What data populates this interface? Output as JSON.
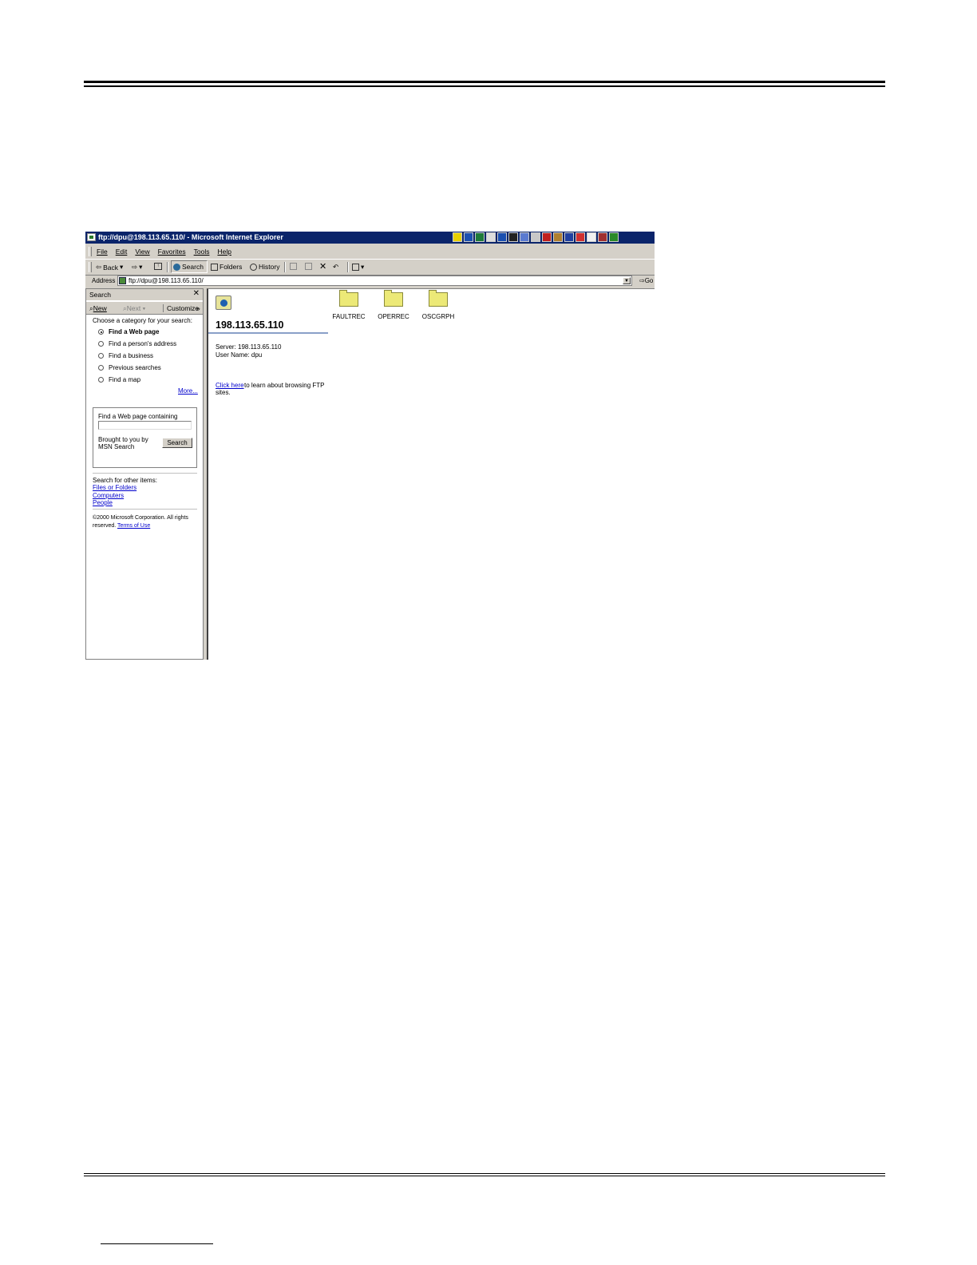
{
  "window": {
    "title": "ftp://dpu@198.113.65.110/ - Microsoft Internet Explorer"
  },
  "menu": [
    "File",
    "Edit",
    "View",
    "Favorites",
    "Tools",
    "Help"
  ],
  "toolbar": {
    "back": "Back",
    "search": "Search",
    "folders": "Folders",
    "history": "History"
  },
  "address": {
    "label": "Address",
    "value": "ftp://dpu@198.113.65.110/",
    "go": "Go"
  },
  "search_pane": {
    "title": "Search",
    "close": "✕",
    "new": "New",
    "next": "Next",
    "customize": "Customize",
    "prompt": "Choose a category for your search:",
    "options": [
      {
        "label": "Find a Web page",
        "selected": true
      },
      {
        "label": "Find a person's address",
        "selected": false
      },
      {
        "label": "Find a business",
        "selected": false
      },
      {
        "label": "Previous searches",
        "selected": false
      },
      {
        "label": "Find a map",
        "selected": false
      }
    ],
    "more": "More...",
    "find_label": "Find a Web page containing",
    "find_value": "",
    "brought_1": "Brought to you by",
    "brought_2": "MSN Search",
    "search_button": "Search",
    "other_label": "Search for other items:",
    "other_links": [
      "Files or Folders",
      "Computers",
      "People"
    ],
    "copyright_1": "©2000 Microsoft Corporation. All rights",
    "copyright_2": "reserved.",
    "terms": "Terms of Use"
  },
  "content": {
    "server_title": "198.113.65.110",
    "server_line": "Server: 198.113.65.110",
    "user_line": "User Name: dpu",
    "click_here": "Click here",
    "click_rest_1": "to learn about browsing FTP",
    "click_rest_2": "sites.",
    "folders": [
      "FAULTREC",
      "OPERREC",
      "OSCGRPH"
    ]
  },
  "colors": {
    "titlebar": "#0a246a",
    "chrome": "#d4d0c8",
    "link": "#0000cc",
    "folder": "#ece977"
  }
}
